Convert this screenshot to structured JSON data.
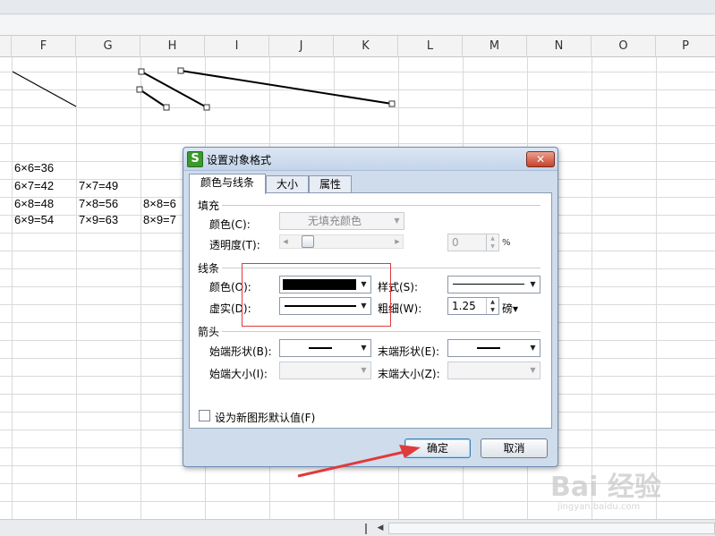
{
  "sheet": {
    "columns": [
      "F",
      "G",
      "H",
      "I",
      "J",
      "K",
      "L",
      "M",
      "N",
      "O",
      "P"
    ],
    "cells": [
      {
        "id": "f181",
        "text": "6×6=36"
      },
      {
        "id": "f201",
        "text": "6×7=42"
      },
      {
        "id": "g201",
        "text": "7×7=49"
      },
      {
        "id": "f221",
        "text": "6×8=48"
      },
      {
        "id": "g221",
        "text": "7×8=56"
      },
      {
        "id": "h221",
        "text": "8×8=6"
      },
      {
        "id": "f241",
        "text": "6×9=54"
      },
      {
        "id": "g241",
        "text": "7×9=63"
      },
      {
        "id": "h241",
        "text": "8×9=7"
      }
    ]
  },
  "dialog": {
    "icon_letter": "S",
    "title": "设置对象格式",
    "close_label": "✕",
    "tabs": [
      {
        "label": "颜色与线条",
        "active": true
      },
      {
        "label": "大小",
        "active": false
      },
      {
        "label": "属性",
        "active": false
      }
    ],
    "fill": {
      "section": "填充",
      "color_label": "颜色(C):",
      "color_value": "无填充颜色",
      "transparency_label": "透明度(T):",
      "transparency_value": "0",
      "transparency_unit": "%",
      "transparency_level": 0.12
    },
    "line": {
      "section": "线条",
      "color_label": "颜色(O):",
      "color_value": "#000000",
      "style_label": "样式(S):",
      "dash_label": "虚实(D):",
      "weight_label": "粗细(W):",
      "weight_value": "1.25",
      "weight_unit": "磅▾"
    },
    "arrows": {
      "section": "箭头",
      "begin_style_label": "始端形状(B):",
      "end_style_label": "末端形状(E):",
      "begin_size_label": "始端大小(I):",
      "end_size_label": "末端大小(Z):"
    },
    "default_checkbox_label": "设为新图形默认值(F)",
    "default_checked": false,
    "ok_label": "确定",
    "cancel_label": "取消"
  },
  "annotation": {
    "highlight_color": "#e03a3a",
    "arrow_color": "#e03a3a"
  },
  "watermark": {
    "main": "Bai 经验",
    "sub": "jingyan.baidu.com"
  }
}
